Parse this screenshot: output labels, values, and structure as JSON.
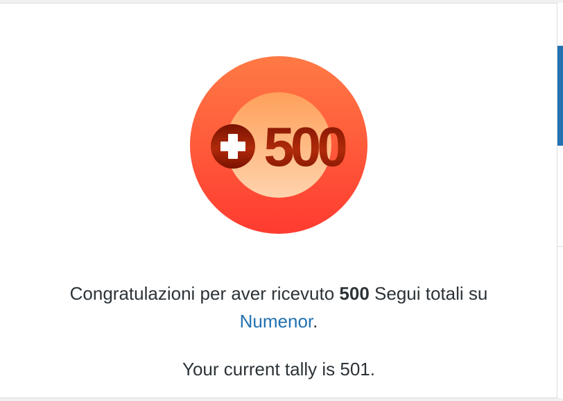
{
  "badge": {
    "icon": "plus-500-milestone-badge",
    "label": "500",
    "colors": {
      "outer_top": "#ff7a45",
      "outer_bottom": "#ff3b30",
      "inner_top": "#ffa05a",
      "inner_bottom": "#ffd0a8",
      "glyph": "#9c1c08"
    }
  },
  "message": {
    "prefix": "Congratulazioni per aver ricevuto ",
    "count": "500",
    "middle": " Segui totali su",
    "site_link": "Numenor",
    "suffix": "."
  },
  "tally": {
    "text": "Your current tally is 501."
  },
  "colors": {
    "link": "#2271b1",
    "text": "#2c3338",
    "side_accent": "#2271b1"
  }
}
